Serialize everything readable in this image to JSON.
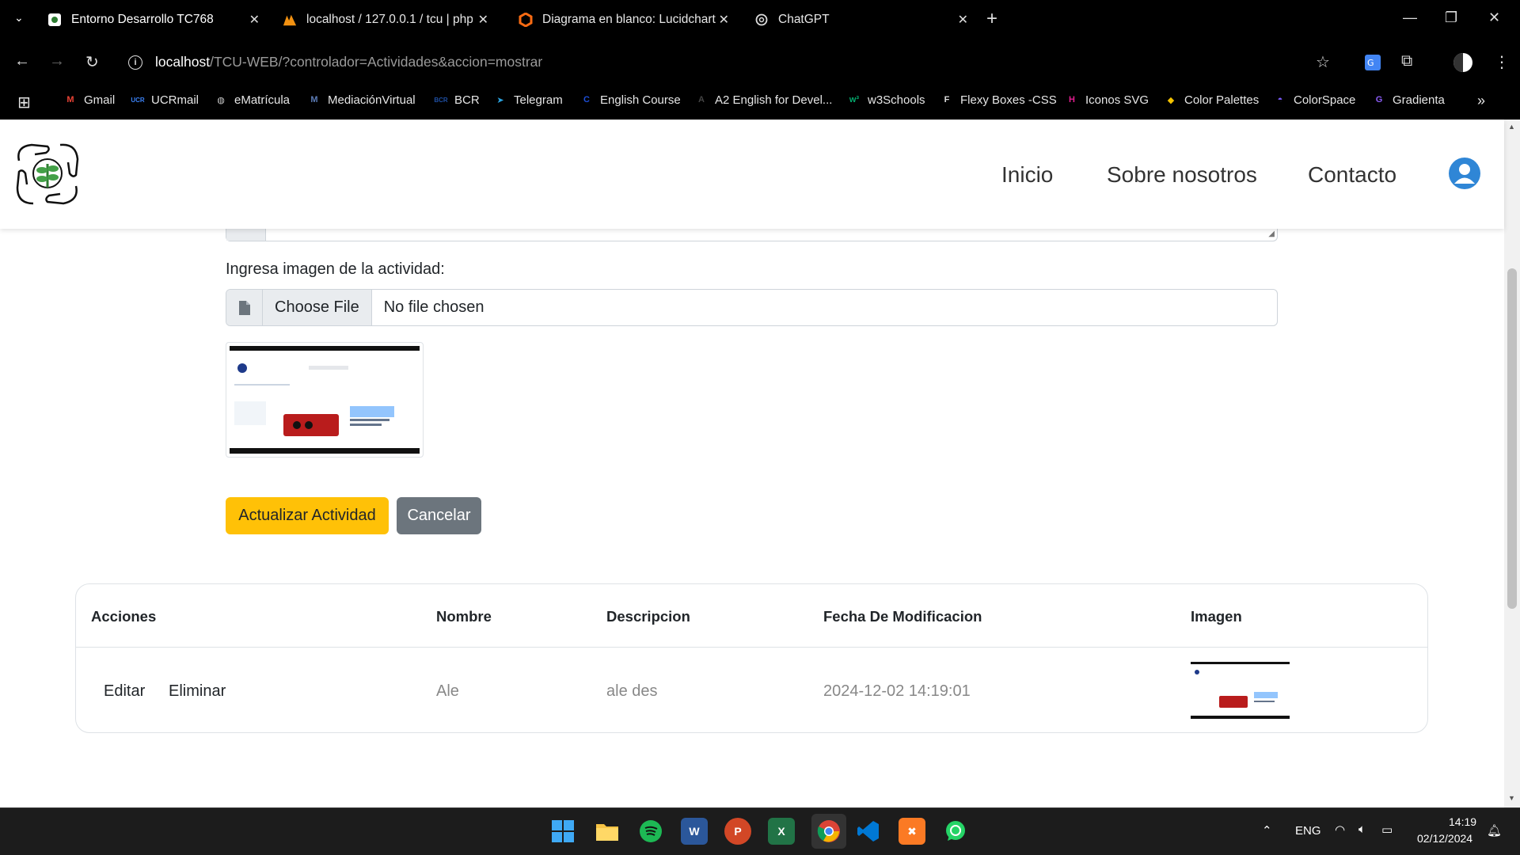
{
  "browser": {
    "tabs": [
      {
        "title": "Entorno Desarrollo TC768",
        "active": true
      },
      {
        "title": "localhost / 127.0.0.1 / tcu | php",
        "active": false
      },
      {
        "title": "Diagrama en blanco: Lucidchart",
        "active": false
      },
      {
        "title": "ChatGPT",
        "active": false
      }
    ],
    "url_host": "localhost",
    "url_path": "/TCU-WEB/?controlador=Actividades&accion=mostrar",
    "bookmarks": [
      {
        "label": "Gmail",
        "icon": "gmail-icon",
        "color": "#ea4335"
      },
      {
        "label": "UCRmail",
        "icon": "ucr-icon",
        "color": "#3b82f6"
      },
      {
        "label": "eMatrícula",
        "icon": "globe-icon",
        "color": "#cccccc"
      },
      {
        "label": "MediaciónVirtual",
        "icon": "moodle-icon",
        "color": "#5b7bb5"
      },
      {
        "label": "BCR",
        "icon": "bcr-icon",
        "color": "#1f4fa3"
      },
      {
        "label": "Telegram",
        "icon": "telegram-icon",
        "color": "#2aa3e0"
      },
      {
        "label": "English Course",
        "icon": "c-icon",
        "color": "#1d4ed8"
      },
      {
        "label": "A2 English for Devel...",
        "icon": "a-icon",
        "color": "#444444"
      },
      {
        "label": "w3Schools",
        "icon": "w3-icon",
        "color": "#04aa6d"
      },
      {
        "label": "Flexy Boxes -CSS",
        "icon": "flexy-icon",
        "color": "#dddddd"
      },
      {
        "label": "Iconos SVG",
        "icon": "svg-icon",
        "color": "#e11d8f"
      },
      {
        "label": "Color Palettes",
        "icon": "palette-icon",
        "color": "#f5c400"
      },
      {
        "label": "ColorSpace",
        "icon": "colorspace-icon",
        "color": "#7c5cff"
      },
      {
        "label": "Gradienta",
        "icon": "gradienta-icon",
        "color": "#8b5cf6"
      }
    ]
  },
  "site": {
    "nav": [
      "Inicio",
      "Sobre nosotros",
      "Contacto"
    ],
    "accent": "#2f86d6"
  },
  "form": {
    "image_label": "Ingresa imagen de la actividad:",
    "choose_file": "Choose File",
    "no_file": "No file chosen",
    "update_button": "Actualizar Actividad",
    "cancel_button": "Cancelar"
  },
  "table": {
    "headers": [
      "Acciones",
      "Nombre",
      "Descripcion",
      "Fecha De Modificacion",
      "Imagen"
    ],
    "rows": [
      {
        "edit": "Editar",
        "delete": "Eliminar",
        "nombre": "Ale",
        "descripcion": "ale des",
        "fecha": "2024-12-02 14:19:01"
      }
    ]
  },
  "taskbar": {
    "lang": "ENG",
    "time": "14:19",
    "date": "02/12/2024"
  }
}
